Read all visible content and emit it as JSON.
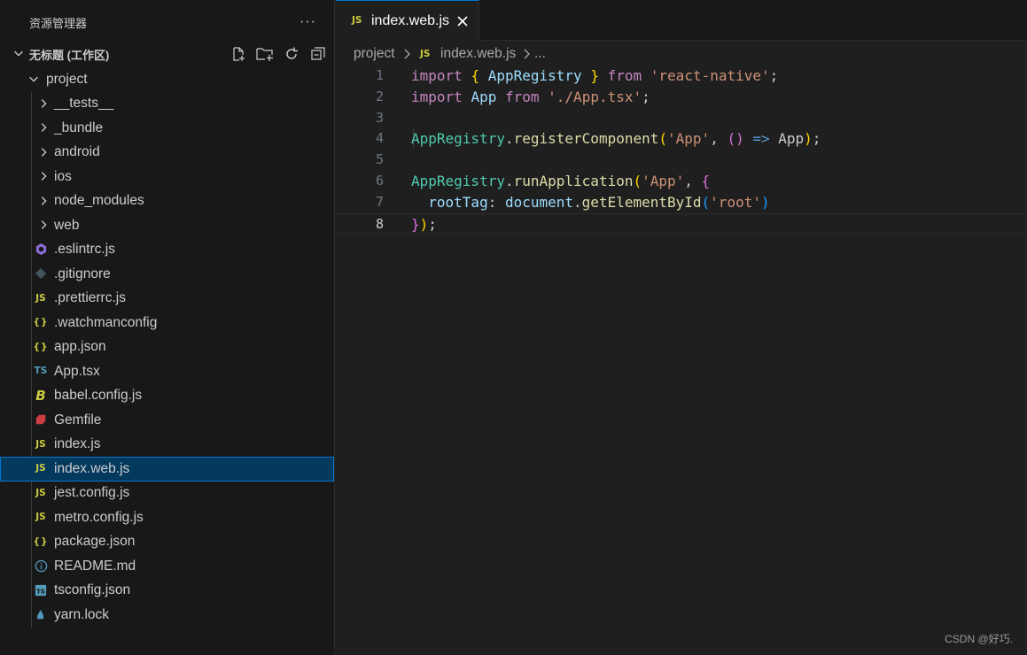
{
  "explorer": {
    "title": "资源管理器",
    "more": "···",
    "workspace_name": "无标题 (工作区)"
  },
  "tree": [
    {
      "label": "project",
      "kind": "folder-open",
      "depth": 1
    },
    {
      "label": "__tests__",
      "kind": "folder",
      "depth": 2
    },
    {
      "label": "_bundle",
      "kind": "folder",
      "depth": 2
    },
    {
      "label": "android",
      "kind": "folder",
      "depth": 2
    },
    {
      "label": "ios",
      "kind": "folder",
      "depth": 2
    },
    {
      "label": "node_modules",
      "kind": "folder",
      "depth": 2
    },
    {
      "label": "web",
      "kind": "folder",
      "depth": 2
    },
    {
      "label": ".eslintrc.js",
      "kind": "eslint",
      "depth": 2
    },
    {
      "label": ".gitignore",
      "kind": "git",
      "depth": 2
    },
    {
      "label": ".prettierrc.js",
      "kind": "js",
      "depth": 2
    },
    {
      "label": ".watchmanconfig",
      "kind": "json",
      "depth": 2
    },
    {
      "label": "app.json",
      "kind": "json",
      "depth": 2
    },
    {
      "label": "App.tsx",
      "kind": "ts",
      "depth": 2
    },
    {
      "label": "babel.config.js",
      "kind": "babel",
      "depth": 2
    },
    {
      "label": "Gemfile",
      "kind": "ruby",
      "depth": 2
    },
    {
      "label": "index.js",
      "kind": "js",
      "depth": 2
    },
    {
      "label": "index.web.js",
      "kind": "js",
      "depth": 2,
      "selected": true
    },
    {
      "label": "jest.config.js",
      "kind": "js",
      "depth": 2
    },
    {
      "label": "metro.config.js",
      "kind": "js",
      "depth": 2
    },
    {
      "label": "package.json",
      "kind": "json",
      "depth": 2
    },
    {
      "label": "README.md",
      "kind": "info",
      "depth": 2
    },
    {
      "label": "tsconfig.json",
      "kind": "tsconfig",
      "depth": 2
    },
    {
      "label": "yarn.lock",
      "kind": "yarn",
      "depth": 2
    }
  ],
  "tab": {
    "icon_text": "JS",
    "label": "index.web.js"
  },
  "breadcrumb": {
    "folder": "project",
    "icon_text": "JS",
    "file": "index.web.js",
    "tail": "..."
  },
  "code_lines": [
    {
      "n": "1",
      "tokens": [
        [
          "kw",
          "import"
        ],
        [
          "pl",
          " "
        ],
        [
          "b1",
          "{"
        ],
        [
          "pl",
          " "
        ],
        [
          "id",
          "AppRegistry"
        ],
        [
          "pl",
          " "
        ],
        [
          "b1",
          "}"
        ],
        [
          "pl",
          " "
        ],
        [
          "kw",
          "from"
        ],
        [
          "pl",
          " "
        ],
        [
          "st",
          "'react-native'"
        ],
        [
          "pl",
          ";"
        ]
      ]
    },
    {
      "n": "2",
      "tokens": [
        [
          "kw",
          "import"
        ],
        [
          "pl",
          " "
        ],
        [
          "id",
          "App"
        ],
        [
          "pl",
          " "
        ],
        [
          "kw",
          "from"
        ],
        [
          "pl",
          " "
        ],
        [
          "st",
          "'./App.tsx'"
        ],
        [
          "pl",
          ";"
        ]
      ]
    },
    {
      "n": "3",
      "tokens": []
    },
    {
      "n": "4",
      "tokens": [
        [
          "ty",
          "AppRegistry"
        ],
        [
          "pl",
          "."
        ],
        [
          "fn",
          "registerComponent"
        ],
        [
          "b1",
          "("
        ],
        [
          "st",
          "'App'"
        ],
        [
          "pl",
          ", "
        ],
        [
          "b2",
          "()"
        ],
        [
          "pl",
          " "
        ],
        [
          "op",
          "=>"
        ],
        [
          "pl",
          " App"
        ],
        [
          "b1",
          ")"
        ],
        [
          "pl",
          ";"
        ]
      ]
    },
    {
      "n": "5",
      "tokens": []
    },
    {
      "n": "6",
      "tokens": [
        [
          "ty",
          "AppRegistry"
        ],
        [
          "pl",
          "."
        ],
        [
          "fn",
          "runApplication"
        ],
        [
          "b1",
          "("
        ],
        [
          "st",
          "'App'"
        ],
        [
          "pl",
          ", "
        ],
        [
          "b2",
          "{"
        ]
      ]
    },
    {
      "n": "7",
      "tokens": [
        [
          "pl",
          "  "
        ],
        [
          "id",
          "rootTag"
        ],
        [
          "pl",
          ": "
        ],
        [
          "id",
          "document"
        ],
        [
          "pl",
          "."
        ],
        [
          "fn",
          "getElementById"
        ],
        [
          "b3",
          "("
        ],
        [
          "st",
          "'root'"
        ],
        [
          "b3",
          ")"
        ]
      ]
    },
    {
      "n": "8",
      "tokens": [
        [
          "b2",
          "}"
        ],
        [
          "b1",
          ")"
        ],
        [
          "pl",
          ";"
        ]
      ],
      "current": true
    }
  ],
  "watermark": "CSDN @好巧.",
  "colors": {
    "accent": "#0078d4",
    "selection": "#04395e",
    "js_icon": "#cbcb41"
  }
}
